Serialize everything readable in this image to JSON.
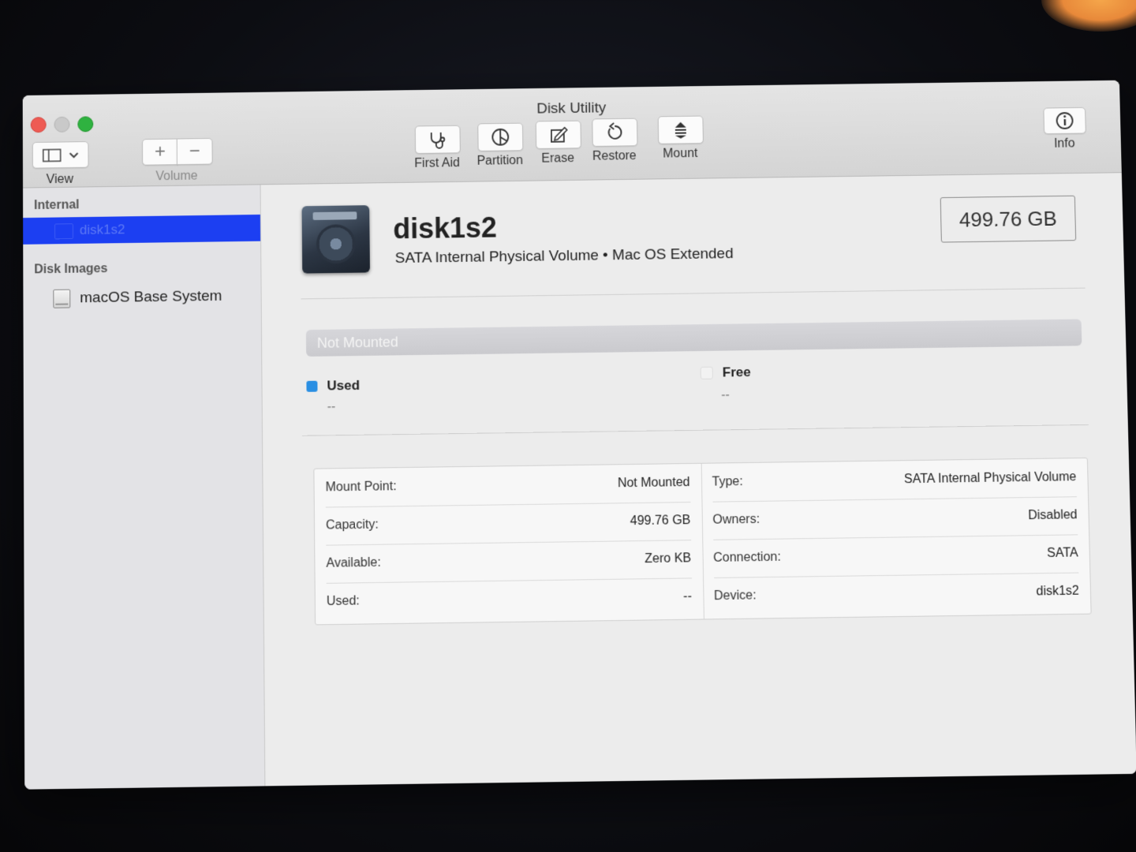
{
  "window": {
    "title": "Disk Utility"
  },
  "toolbar": {
    "view_label": "View",
    "volume_label": "Volume",
    "volume_add": "+",
    "volume_remove": "−",
    "first_aid_label": "First Aid",
    "partition_label": "Partition",
    "erase_label": "Erase",
    "restore_label": "Restore",
    "mount_label": "Mount",
    "info_label": "Info"
  },
  "sidebar": {
    "internal_header": "Internal",
    "selected_item": "disk1s2",
    "disk_images_header": "Disk Images",
    "disk_image_item": "macOS Base System"
  },
  "detail": {
    "name": "disk1s2",
    "description": "SATA Internal Physical Volume • Mac OS Extended",
    "size": "499.76 GB",
    "usage_bar_label": "Not Mounted",
    "used_label": "Used",
    "used_value": "--",
    "free_label": "Free",
    "free_value": "--",
    "used_color": "#2a8fe3",
    "free_color": "#f2f2f2"
  },
  "info": {
    "left": [
      {
        "label": "Mount Point:",
        "value": "Not Mounted"
      },
      {
        "label": "Capacity:",
        "value": "499.76 GB"
      },
      {
        "label": "Available:",
        "value": "Zero KB"
      },
      {
        "label": "Used:",
        "value": "--"
      }
    ],
    "right": [
      {
        "label": "Type:",
        "value": "SATA Internal Physical Volume"
      },
      {
        "label": "Owners:",
        "value": "Disabled"
      },
      {
        "label": "Connection:",
        "value": "SATA"
      },
      {
        "label": "Device:",
        "value": "disk1s2"
      }
    ]
  }
}
